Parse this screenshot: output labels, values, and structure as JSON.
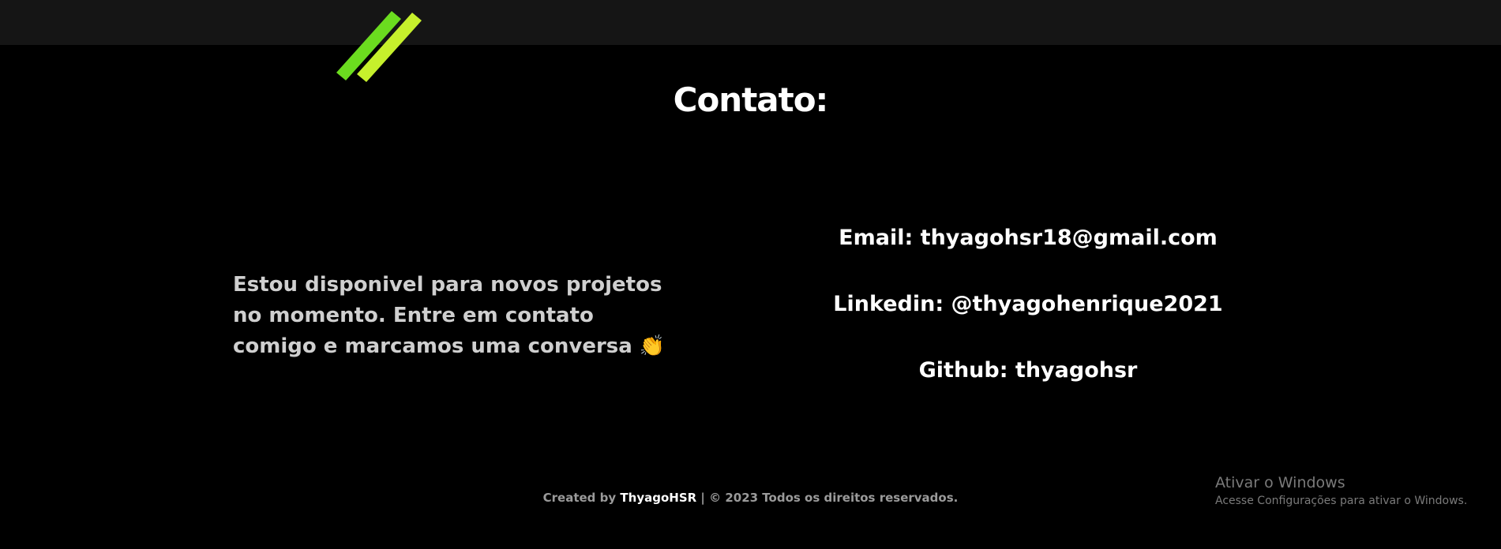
{
  "header": {
    "logo_name": "logo-slashes",
    "colors": {
      "bar": "#151515",
      "logo_left": "#6bdc1f",
      "logo_right": "#c6f02c"
    }
  },
  "contact": {
    "title": "Contato:",
    "intro": "Estou disponivel para novos projetos no momento. Entre em contato comigo e marcamos uma conversa",
    "intro_emoji": "👏",
    "email": "Email: thyagohsr18@gmail.com",
    "linkedin": "Linkedin: @thyagohenrique2021",
    "github": "Github: thyagohsr"
  },
  "footer": {
    "prefix": "Created by",
    "brand": "ThyagoHSR",
    "suffix": "| © 2023 Todos os direitos reservados."
  },
  "windows_watermark": {
    "title": "Ativar o Windows",
    "subtitle": "Acesse Configurações para ativar o Windows."
  }
}
